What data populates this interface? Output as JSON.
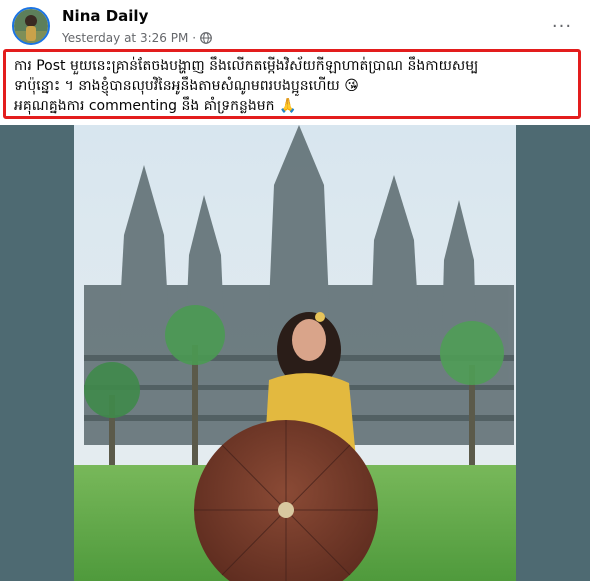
{
  "post": {
    "author": "Nina Daily",
    "timestamp": "Yesterday at 3:26 PM",
    "separator": "·",
    "privacy_icon": "globe-icon",
    "more_icon": "more-options-icon",
    "more_label": "···",
    "caption_lines": [
      "ការ Post មួយនេះគ្រាន់តែចងបង្ហាញ នឹងលើកតម្កើងវិស័យកីឡាហាត់ប្រាណ នឹងកាយសម្ប",
      "ទាប៉ុន្នោះ ។ នាងខ្ញុំបានលុបវិនៃអូនឹងតាមសំណូមពរបងប្អូនហើយ 😘",
      "អគុណគ្នងការ commenting នឹង គាំទ្រកន្លងមក 🙏"
    ]
  },
  "colors": {
    "highlight_border": "#e31d1d",
    "photo_background": "#4e6a72",
    "accent": "#1b74e4"
  }
}
